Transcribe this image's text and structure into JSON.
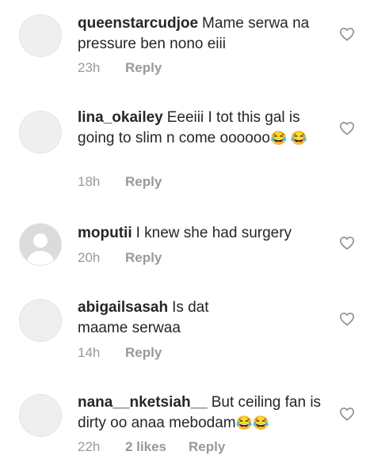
{
  "comments": [
    {
      "username": "queenstarcudjoe",
      "text": "Mame serwa na pressure ben nono eiii",
      "emoji": "",
      "time": "23h",
      "likes": "",
      "reply": "Reply"
    },
    {
      "username": "lina_okailey",
      "text": "Eeeiii I tot this gal is going to slim n come oooooo",
      "emoji": "😂 😂",
      "time": "18h",
      "likes": "",
      "reply": "Reply"
    },
    {
      "username": "moputii",
      "text": "I knew she had surgery",
      "emoji": "",
      "time": "20h",
      "likes": "",
      "reply": "Reply"
    },
    {
      "username": "abigailsasah",
      "text": "Is dat maame serwaa",
      "emoji": "",
      "time": "14h",
      "likes": "",
      "reply": "Reply"
    },
    {
      "username": "nana__nketsiah__",
      "text": "But ceiling fan is dirty oo anaa mebodam",
      "emoji": "😂😂",
      "time": "22h",
      "likes": "2 likes",
      "reply": "Reply"
    }
  ],
  "icons": {
    "like": "heart-outline-icon",
    "avatar": "default-avatar-icon"
  }
}
